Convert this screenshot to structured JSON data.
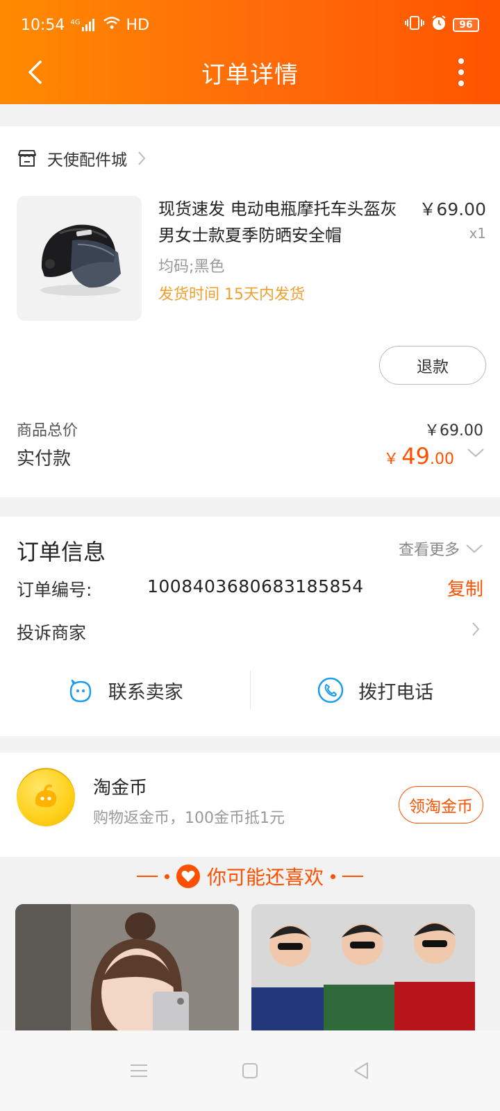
{
  "status_bar": {
    "time": "10:54",
    "network": "4G",
    "hd": "HD",
    "battery": "96"
  },
  "header": {
    "title": "订单详情"
  },
  "shop": {
    "name": "天使配件城"
  },
  "product": {
    "title": "现货速发 电动电瓶摩托车头盔灰男女士款夏季防晒安全帽",
    "price": "￥69.00",
    "qty": "x1",
    "spec": "均码;黑色",
    "ship": "发货时间 15天内发货",
    "refund_label": "退款"
  },
  "summary": {
    "total_label": "商品总价",
    "total_value": "￥69.00",
    "paid_label": "实付款",
    "paid_currency": "￥",
    "paid_int": "49",
    "paid_dec": ".00"
  },
  "order_info": {
    "title": "订单信息",
    "more": "查看更多",
    "order_no_label": "订单编号:",
    "order_no": "1008403680683185854",
    "copy": "复制",
    "complain": "投诉商家",
    "contact_seller": "联系卖家",
    "call": "拨打电话"
  },
  "coins": {
    "title": "淘金币",
    "subtitle": "购物返金币，100金币抵1元",
    "button": "领淘金币"
  },
  "recommend": {
    "title": "你可能还喜欢"
  },
  "colors": {
    "accent": "#ff5000",
    "ship_text": "#f0a030",
    "header_start": "#ff8a00",
    "header_end": "#ff5500"
  }
}
